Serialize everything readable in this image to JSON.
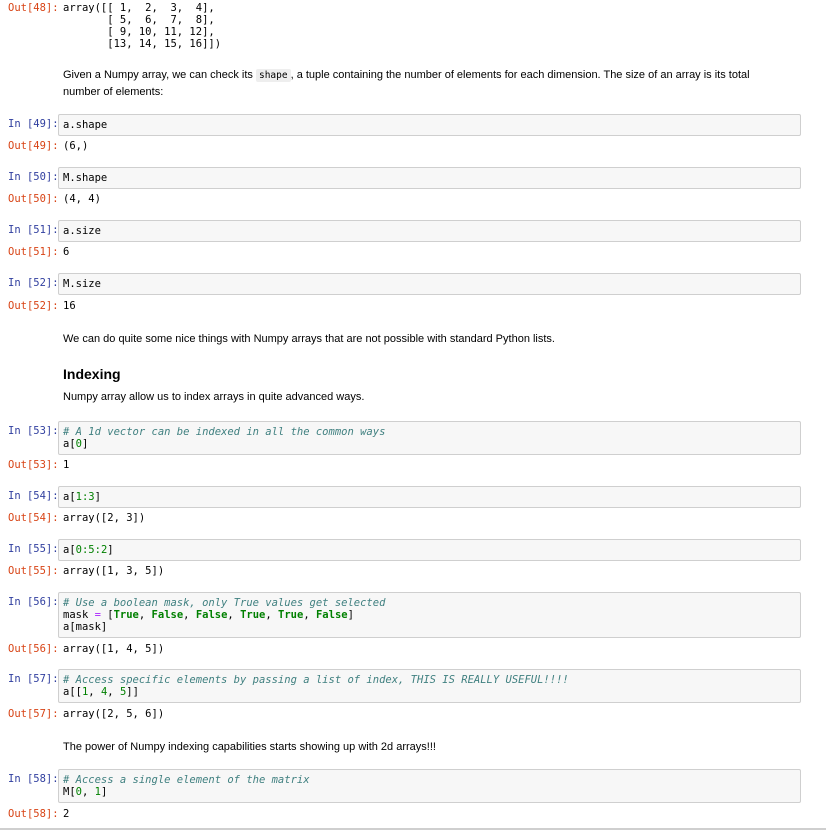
{
  "cells": {
    "out48": {
      "prompt": "Out[48]:",
      "lines": [
        "array([[ 1,  2,  3,  4],",
        "       [ 5,  6,  7,  8],",
        "       [ 9, 10, 11, 12],",
        "       [13, 14, 15, 16]])"
      ]
    },
    "md1": {
      "before": "Given a Numpy array, we can check its ",
      "code": "shape",
      "after": ", a tuple containing the number of elements for each dimension. The size of an array is its total number of elements:"
    },
    "c49": {
      "in_prompt": "In [49]:",
      "code": "a.shape",
      "out_prompt": "Out[49]:",
      "output": "(6,)"
    },
    "c50": {
      "in_prompt": "In [50]:",
      "code": "M.shape",
      "out_prompt": "Out[50]:",
      "output": "(4, 4)"
    },
    "c51": {
      "in_prompt": "In [51]:",
      "code": "a.size",
      "out_prompt": "Out[51]:",
      "output": "6"
    },
    "c52": {
      "in_prompt": "In [52]:",
      "code": "M.size",
      "out_prompt": "Out[52]:",
      "output": "16"
    },
    "md2": {
      "text": "We can do quite some nice things with Numpy arrays that are not possible with standard Python lists."
    },
    "md3": {
      "heading": "Indexing",
      "text": "Numpy array allow us to index arrays in quite advanced ways."
    },
    "c53": {
      "in_prompt": "In [53]:",
      "comment": "# A 1d vector can be indexed in all the common ways",
      "code_a": "a[",
      "num": "0",
      "code_b": "]",
      "out_prompt": "Out[53]:",
      "output": "1"
    },
    "c54": {
      "in_prompt": "In [54]:",
      "code_a": "a[",
      "nums": "1:3",
      "code_b": "]",
      "out_prompt": "Out[54]:",
      "output": "array([2, 3])"
    },
    "c55": {
      "in_prompt": "In [55]:",
      "code_a": "a[",
      "nums": "0:5:2",
      "code_b": "]",
      "out_prompt": "Out[55]:",
      "output": "array([1, 3, 5])"
    },
    "c56": {
      "in_prompt": "In [56]:",
      "comment": "# Use a boolean mask, only True values get selected",
      "line2_var": "mask ",
      "line2_op": "=",
      "line2_open": " [",
      "bools": [
        "True",
        "False",
        "False",
        "True",
        "True",
        "False"
      ],
      "line3": "a[mask]",
      "out_prompt": "Out[56]:",
      "output": "array([1, 4, 5])"
    },
    "c57": {
      "in_prompt": "In [57]:",
      "comment": "# Access specific elements by passing a list of index, THIS IS REALLY USEFUL!!!!",
      "code_a": "a[[",
      "n1": "1",
      "n2": "4",
      "n3": "5",
      "code_b": "]]",
      "out_prompt": "Out[57]:",
      "output": "array([2, 5, 6])"
    },
    "md4": {
      "text": "The power of Numpy indexing capabilities starts showing up with 2d arrays!!!"
    },
    "c58": {
      "in_prompt": "In [58]:",
      "comment": "# Access a single element of the matrix",
      "code_a": "M[",
      "n1": "0",
      "n2": "1",
      "code_b": "]",
      "out_prompt": "Out[58]:",
      "output": "2"
    }
  }
}
